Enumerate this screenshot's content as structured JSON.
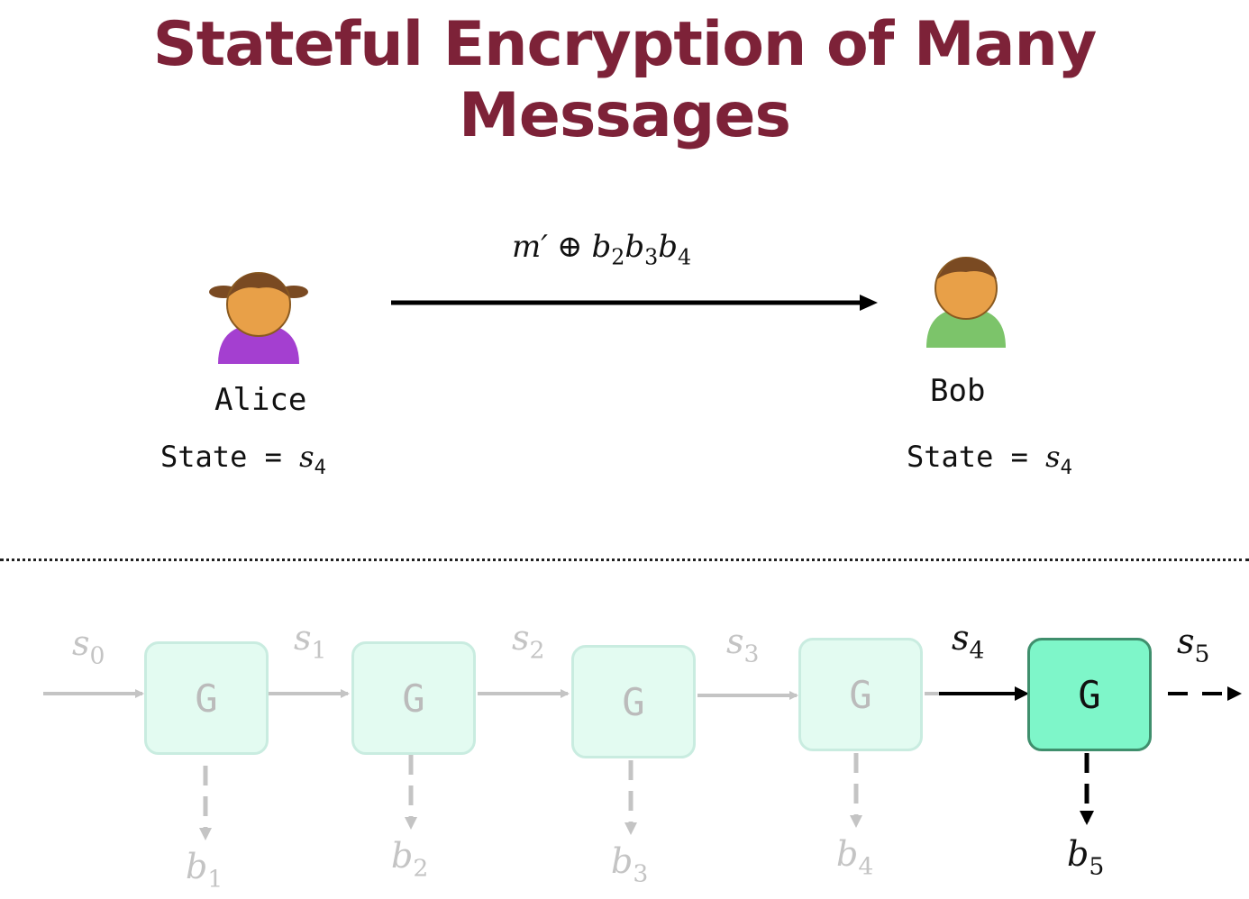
{
  "title": "Stateful Encryption of Many Messages",
  "alice": {
    "name": "Alice",
    "state_prefix": "State = ",
    "state_var": "s",
    "state_sub": "4"
  },
  "bob": {
    "name": "Bob",
    "state_prefix": "State = ",
    "state_var": "s",
    "state_sub": "4"
  },
  "message": {
    "m": "m′",
    "op": "⊕",
    "parts": [
      {
        "var": "b",
        "sub": "2"
      },
      {
        "var": "b",
        "sub": "3"
      },
      {
        "var": "b",
        "sub": "4"
      }
    ]
  },
  "chain": {
    "box_label": "G",
    "states": [
      {
        "var": "s",
        "sub": "0"
      },
      {
        "var": "s",
        "sub": "1"
      },
      {
        "var": "s",
        "sub": "2"
      },
      {
        "var": "s",
        "sub": "3"
      },
      {
        "var": "s",
        "sub": "4"
      },
      {
        "var": "s",
        "sub": "5"
      }
    ],
    "outputs": [
      {
        "var": "b",
        "sub": "1"
      },
      {
        "var": "b",
        "sub": "2"
      },
      {
        "var": "b",
        "sub": "3"
      },
      {
        "var": "b",
        "sub": "4"
      },
      {
        "var": "b",
        "sub": "5"
      }
    ],
    "active_index": 4
  },
  "colors": {
    "title": "#7d2238",
    "alice_body": "#a43fd0",
    "bob_body": "#7cc46a",
    "face": "#e8a048",
    "hair": "#7a4a22",
    "active_box": "#7ef6c9",
    "faded_box": "#e3fbf1"
  }
}
